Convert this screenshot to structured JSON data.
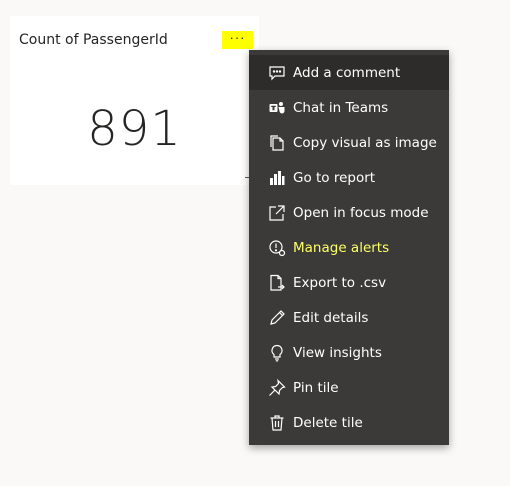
{
  "tile": {
    "title": "Count of PassengerId",
    "value": "891",
    "more_label": "···"
  },
  "menu": {
    "items": [
      {
        "label": "Add a comment",
        "icon": "comment-icon"
      },
      {
        "label": "Chat in Teams",
        "icon": "teams-icon"
      },
      {
        "label": "Copy visual as image",
        "icon": "copy-icon"
      },
      {
        "label": "Go to report",
        "icon": "bar-chart-icon"
      },
      {
        "label": "Open in focus mode",
        "icon": "focus-mode-icon"
      },
      {
        "label": "Manage alerts",
        "icon": "alert-icon"
      },
      {
        "label": "Export to .csv",
        "icon": "export-icon"
      },
      {
        "label": "Edit details",
        "icon": "pencil-icon"
      },
      {
        "label": "View insights",
        "icon": "lightbulb-icon"
      },
      {
        "label": "Pin tile",
        "icon": "pin-icon"
      },
      {
        "label": "Delete tile",
        "icon": "trash-icon"
      }
    ]
  },
  "colors": {
    "menu_bg": "#3b3a39",
    "menu_hover": "#2d2c2b",
    "highlight": "#ffff00"
  }
}
